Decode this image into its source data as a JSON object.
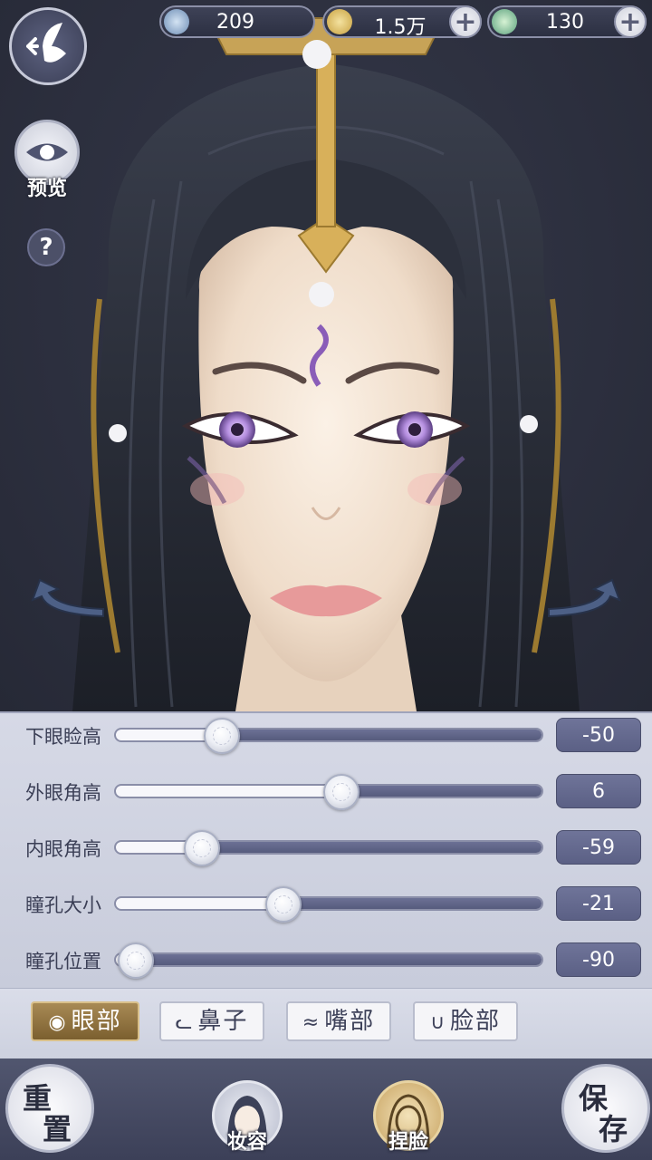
{
  "currency": [
    {
      "icon": "feather-coin-icon",
      "value": "209",
      "has_plus": false
    },
    {
      "icon": "copper-coin-icon",
      "value": "1.5万",
      "has_plus": true
    },
    {
      "icon": "jade-dragon-icon",
      "value": "130",
      "has_plus": true
    }
  ],
  "top_buttons": {
    "back_icon": "butterfly-back-icon",
    "preview_label": "预览",
    "help_label": "?"
  },
  "sliders": [
    {
      "label": "下眼睑高",
      "value": "-50",
      "level": 0.25
    },
    {
      "label": "外眼角高",
      "value": "6",
      "level": 0.53
    },
    {
      "label": "内眼角高",
      "value": "-59",
      "level": 0.205
    },
    {
      "label": "瞳孔大小",
      "value": "-21",
      "level": 0.395
    },
    {
      "label": "瞳孔位置",
      "value": "-90",
      "level": 0.05
    }
  ],
  "tabs": [
    {
      "label": "眼部",
      "icon": "eye-icon",
      "active": true
    },
    {
      "label": "鼻子",
      "icon": "nose-icon",
      "active": false
    },
    {
      "label": "嘴部",
      "icon": "mouth-icon",
      "active": false
    },
    {
      "label": "脸部",
      "icon": "face-icon",
      "active": false
    }
  ],
  "bottom": {
    "reset_label_1": "重",
    "reset_label_2": "置",
    "makeup_label": "妆容",
    "face_label": "捏脸",
    "save_label_1": "保",
    "save_label_2": "存"
  },
  "colors": {
    "accent_gold": "#a88a55",
    "slider_fill": "#5b6085",
    "panel_bg": "#d6d9e6",
    "bottom_bar": "#474b63"
  }
}
